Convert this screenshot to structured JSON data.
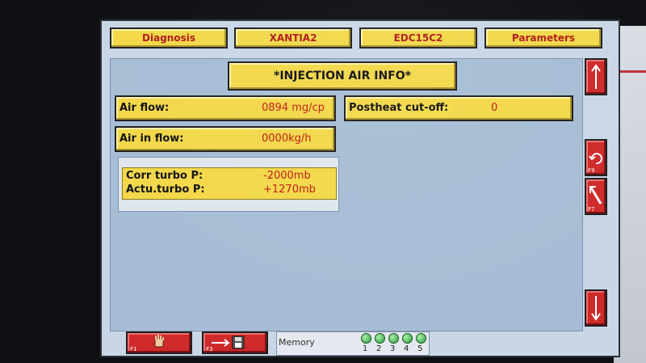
{
  "tabs": [
    {
      "label": "Diagnosis"
    },
    {
      "label": "XANTIA2"
    },
    {
      "label": "EDC15C2"
    },
    {
      "label": "Parameters"
    }
  ],
  "title": "*INJECTION AIR INFO*",
  "fields": {
    "air_flow": {
      "label": "Air flow:",
      "value": "0894 mg/cp"
    },
    "postheat": {
      "label": "Postheat cut-off:",
      "value": "0"
    },
    "air_in_flow": {
      "label": "Air in flow:",
      "value": "0000kg/h"
    }
  },
  "turbo": {
    "corr": {
      "label": "Corr turbo P:",
      "value": "-2000mb"
    },
    "actu": {
      "label": "Actu.turbo P:",
      "value": "+1270mb"
    }
  },
  "side_buttons": {
    "up": {
      "icon": "arrow-up-icon"
    },
    "refresh": {
      "icon": "refresh-icon",
      "key": "F9"
    },
    "exit": {
      "icon": "arrow-diagonal-icon",
      "key": "F7"
    },
    "down": {
      "icon": "arrow-down-icon"
    }
  },
  "bottom_buttons": {
    "stop": {
      "icon": "hand-icon",
      "key": "F1"
    },
    "save": {
      "icon": "save-to-disk-icon",
      "key": "F3"
    }
  },
  "memory": {
    "label": "Memory",
    "slots": [
      "1",
      "2",
      "3",
      "4",
      "5"
    ],
    "led_color": "#3fbf4f"
  },
  "colors": {
    "field_yellow": "#f3d84a",
    "value_red": "#c31a14",
    "button_red": "#cf2a2a",
    "panel_blue": "#a7bdd5"
  }
}
